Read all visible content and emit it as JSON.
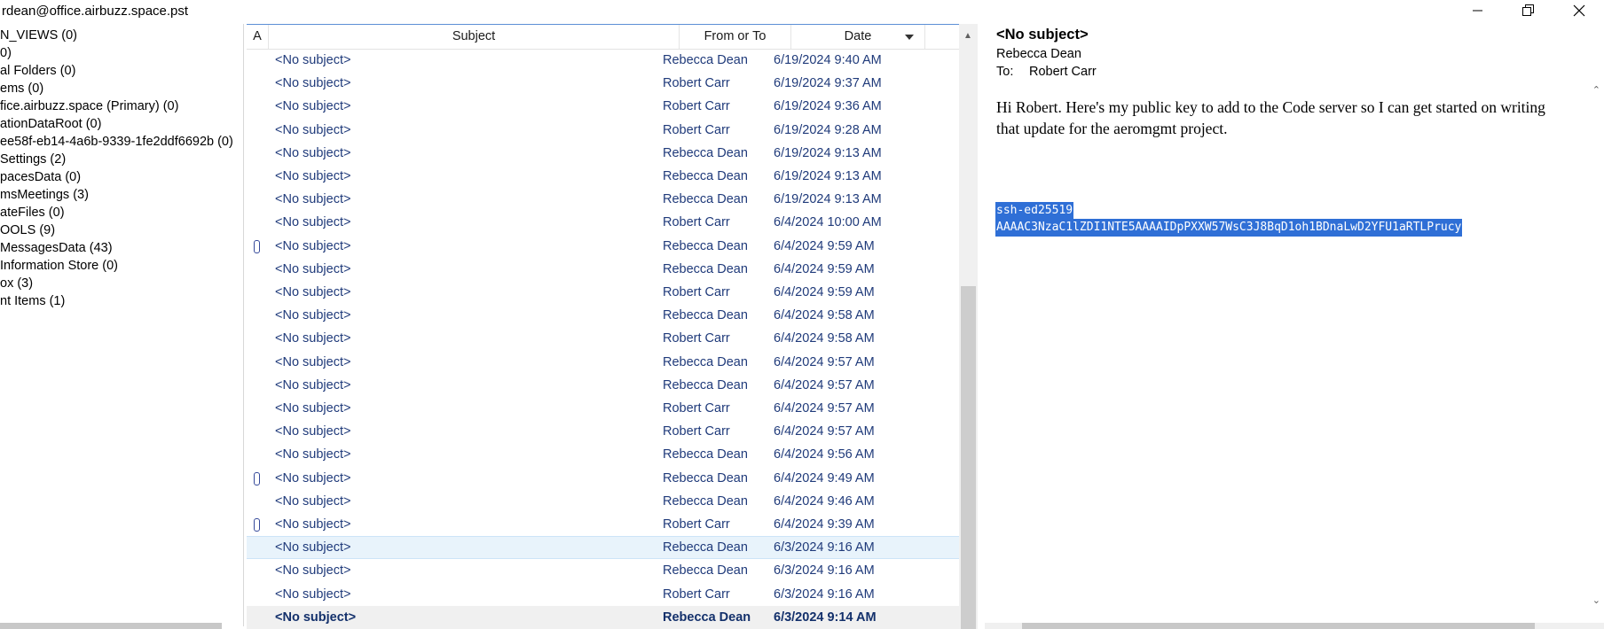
{
  "window": {
    "title": "rdean@office.airbuzz.space.pst",
    "minimize_icon": "minimize-icon",
    "restore_icon": "restore-icon",
    "close_icon": "close-icon"
  },
  "folders": [
    "N_VIEWS (0)",
    "0)",
    "al Folders (0)",
    "ems (0)",
    "fice.airbuzz.space (Primary) (0)",
    "ationDataRoot (0)",
    "ee58f-eb14-4a6b-9339-1fe2ddf6692b (0)",
    " Settings (2)",
    "pacesData (0)",
    "msMeetings (3)",
    "ateFiles (0)",
    "OOLS (9)",
    "MessagesData (43)",
    " Information Store (0)",
    "ox (3)",
    "nt Items (1)"
  ],
  "list": {
    "columns": {
      "attach": "A",
      "subject": "Subject",
      "from_to": "From or To",
      "date": "Date"
    },
    "rows": [
      {
        "subject": "<No subject>",
        "from": "Rebecca Dean",
        "date": "6/19/2024 9:40 AM",
        "attach": false
      },
      {
        "subject": "<No subject>",
        "from": "Robert Carr",
        "date": "6/19/2024 9:37 AM",
        "attach": false
      },
      {
        "subject": "<No subject>",
        "from": "Robert Carr",
        "date": "6/19/2024 9:36 AM",
        "attach": false
      },
      {
        "subject": "<No subject>",
        "from": "Robert Carr",
        "date": "6/19/2024 9:28 AM",
        "attach": false
      },
      {
        "subject": "<No subject>",
        "from": "Rebecca Dean",
        "date": "6/19/2024 9:13 AM",
        "attach": false
      },
      {
        "subject": "<No subject>",
        "from": "Rebecca Dean",
        "date": "6/19/2024 9:13 AM",
        "attach": false
      },
      {
        "subject": "<No subject>",
        "from": "Rebecca Dean",
        "date": "6/19/2024 9:13 AM",
        "attach": false
      },
      {
        "subject": "<No subject>",
        "from": "Robert Carr",
        "date": "6/4/2024 10:00 AM",
        "attach": false
      },
      {
        "subject": "<No subject>",
        "from": "Rebecca Dean",
        "date": "6/4/2024 9:59 AM",
        "attach": true
      },
      {
        "subject": "<No subject>",
        "from": "Rebecca Dean",
        "date": "6/4/2024 9:59 AM",
        "attach": false
      },
      {
        "subject": "<No subject>",
        "from": "Robert Carr",
        "date": "6/4/2024 9:59 AM",
        "attach": false
      },
      {
        "subject": "<No subject>",
        "from": "Rebecca Dean",
        "date": "6/4/2024 9:58 AM",
        "attach": false
      },
      {
        "subject": "<No subject>",
        "from": "Robert Carr",
        "date": "6/4/2024 9:58 AM",
        "attach": false
      },
      {
        "subject": "<No subject>",
        "from": "Rebecca Dean",
        "date": "6/4/2024 9:57 AM",
        "attach": false
      },
      {
        "subject": "<No subject>",
        "from": "Rebecca Dean",
        "date": "6/4/2024 9:57 AM",
        "attach": false
      },
      {
        "subject": "<No subject>",
        "from": "Robert Carr",
        "date": "6/4/2024 9:57 AM",
        "attach": false
      },
      {
        "subject": "<No subject>",
        "from": "Robert Carr",
        "date": "6/4/2024 9:57 AM",
        "attach": false
      },
      {
        "subject": "<No subject>",
        "from": "Rebecca Dean",
        "date": "6/4/2024 9:56 AM",
        "attach": false
      },
      {
        "subject": "<No subject>",
        "from": "Rebecca Dean",
        "date": "6/4/2024 9:49 AM",
        "attach": true
      },
      {
        "subject": "<No subject>",
        "from": "Rebecca Dean",
        "date": "6/4/2024 9:46 AM",
        "attach": false
      },
      {
        "subject": "<No subject>",
        "from": "Robert Carr",
        "date": "6/4/2024 9:39 AM",
        "attach": true
      },
      {
        "subject": "<No subject>",
        "from": "Rebecca Dean",
        "date": "6/3/2024 9:16 AM",
        "attach": false,
        "state": "selected"
      },
      {
        "subject": "<No subject>",
        "from": "Rebecca Dean",
        "date": "6/3/2024 9:16 AM",
        "attach": false
      },
      {
        "subject": "<No subject>",
        "from": "Robert Carr",
        "date": "6/3/2024 9:16 AM",
        "attach": false
      },
      {
        "subject": "<No subject>",
        "from": "Rebecca Dean",
        "date": "6/3/2024 9:14 AM",
        "attach": false,
        "state": "unread"
      }
    ]
  },
  "message": {
    "subject": "<No subject>",
    "from": "Rebecca Dean",
    "to_label": "To:",
    "to": "Robert Carr",
    "body": "Hi Robert. Here's my public key to add to the Code server so I can get started on writing that update for the aeromgmt project.",
    "key_line1": "ssh-ed25519 ",
    "key_line2": "AAAAC3NzaC1lZDI1NTE5AAAAIDpPXXW57WsC3J8BqD1oh1BDnaLwD2YFU1aRTLPrucy"
  },
  "colors": {
    "accent": "#2f6fd6",
    "link_text": "#1f3a7a",
    "selected_row": "#e8f3fb"
  }
}
